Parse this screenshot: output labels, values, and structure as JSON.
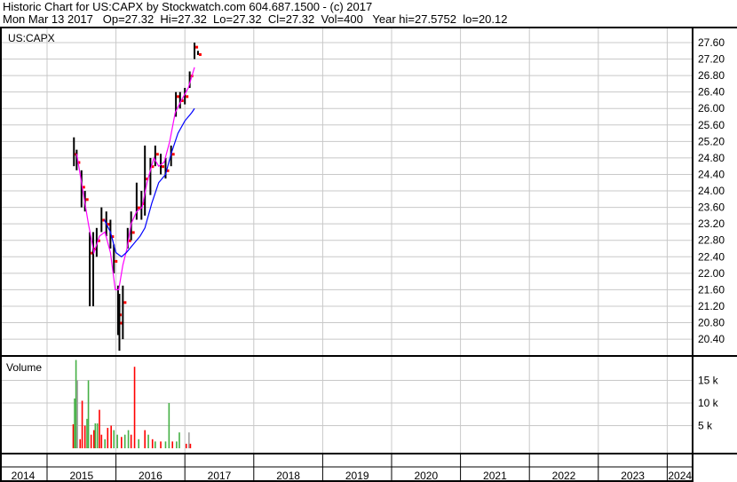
{
  "header": {
    "line1": "Historic Chart for US:CAPX by Stockwatch.com 604.687.1500 - (c) 2017",
    "line2": "Mon Mar 13 2017   Op=27.32  Hi=27.32  Lo=27.32  Cl=27.32  Vol=400   Year hi=27.5752  lo=20.12"
  },
  "chart_data": {
    "type": "line",
    "title": "US:CAPX",
    "volume_label": "Volume",
    "price_ticks": [
      "27.60",
      "27.20",
      "26.80",
      "26.40",
      "26.00",
      "25.60",
      "25.20",
      "24.80",
      "24.40",
      "24.00",
      "23.60",
      "23.20",
      "22.80",
      "22.40",
      "22.00",
      "21.60",
      "21.20",
      "20.80",
      "20.40"
    ],
    "volume_ticks": [
      "15 k",
      "10 k",
      "5 k"
    ],
    "volume_tick_values": [
      15,
      10,
      5
    ],
    "years": [
      "2014",
      "2015",
      "2016",
      "2017",
      "2018",
      "2019",
      "2020",
      "2021",
      "2022",
      "2023",
      "2024"
    ],
    "ylim": [
      20.4,
      27.6
    ],
    "colors": {
      "up": "#44b044",
      "down": "#ff0000",
      "flat": "#a0a0a0",
      "bar": "#000000",
      "ma_short": "#ff00ff",
      "ma_long": "#0000ff"
    },
    "price": [
      {
        "t": 2015.39,
        "h": 25.3,
        "l": 24.6,
        "c": 24.9
      },
      {
        "t": 2015.43,
        "h": 25.0,
        "l": 24.5,
        "c": 24.7
      },
      {
        "t": 2015.5,
        "h": 24.5,
        "l": 23.6,
        "c": 24.1
      },
      {
        "t": 2015.55,
        "h": 24.0,
        "l": 23.5,
        "c": 23.8
      },
      {
        "t": 2015.62,
        "h": 23.0,
        "l": 21.2,
        "c": 22.5
      },
      {
        "t": 2015.67,
        "h": 23.0,
        "l": 21.2,
        "c": 22.6
      },
      {
        "t": 2015.72,
        "h": 23.1,
        "l": 22.4,
        "c": 22.8
      },
      {
        "t": 2015.79,
        "h": 23.6,
        "l": 23.0,
        "c": 23.3
      },
      {
        "t": 2015.86,
        "h": 23.5,
        "l": 22.9,
        "c": 23.2
      },
      {
        "t": 2015.92,
        "h": 23.3,
        "l": 22.6,
        "c": 22.9
      },
      {
        "t": 2015.97,
        "h": 22.7,
        "l": 22.0,
        "c": 22.3
      },
      {
        "t": 2016.03,
        "h": 21.7,
        "l": 20.5,
        "c": 21.0
      },
      {
        "t": 2016.05,
        "h": 21.5,
        "l": 20.12,
        "c": 20.8
      },
      {
        "t": 2016.1,
        "h": 21.7,
        "l": 20.4,
        "c": 21.3
      },
      {
        "t": 2016.17,
        "h": 23.1,
        "l": 22.6,
        "c": 22.8
      },
      {
        "t": 2016.22,
        "h": 23.5,
        "l": 22.8,
        "c": 23.0
      },
      {
        "t": 2016.3,
        "h": 24.2,
        "l": 23.3,
        "c": 23.6
      },
      {
        "t": 2016.37,
        "h": 24.0,
        "l": 23.3,
        "c": 23.7
      },
      {
        "t": 2016.42,
        "h": 25.1,
        "l": 23.4,
        "c": 24.3
      },
      {
        "t": 2016.5,
        "h": 24.8,
        "l": 23.9,
        "c": 24.6
      },
      {
        "t": 2016.57,
        "h": 25.1,
        "l": 24.6,
        "c": 24.9
      },
      {
        "t": 2016.65,
        "h": 24.9,
        "l": 24.4,
        "c": 24.6
      },
      {
        "t": 2016.72,
        "h": 24.8,
        "l": 24.3,
        "c": 24.5
      },
      {
        "t": 2016.8,
        "h": 25.1,
        "l": 24.6,
        "c": 24.9
      },
      {
        "t": 2016.87,
        "h": 26.4,
        "l": 25.8,
        "c": 26.3
      },
      {
        "t": 2016.93,
        "h": 26.4,
        "l": 26.0,
        "c": 26.2
      },
      {
        "t": 2017.0,
        "h": 26.5,
        "l": 26.1,
        "c": 26.3
      },
      {
        "t": 2017.07,
        "h": 26.9,
        "l": 26.5,
        "c": 26.8
      },
      {
        "t": 2017.14,
        "h": 27.6,
        "l": 27.2,
        "c": 27.5
      },
      {
        "t": 2017.19,
        "h": 27.4,
        "l": 27.3,
        "c": 27.32
      }
    ],
    "ma_short": [
      [
        2015.43,
        24.9
      ],
      [
        2015.52,
        24.0
      ],
      [
        2015.6,
        23.2
      ],
      [
        2015.68,
        22.5
      ],
      [
        2015.76,
        22.9
      ],
      [
        2015.84,
        23.0
      ],
      [
        2015.92,
        22.5
      ],
      [
        2015.99,
        21.6
      ],
      [
        2016.04,
        21.6
      ],
      [
        2016.1,
        22.2
      ],
      [
        2016.16,
        22.6
      ],
      [
        2016.22,
        23.2
      ],
      [
        2016.3,
        23.5
      ],
      [
        2016.38,
        23.6
      ],
      [
        2016.45,
        24.2
      ],
      [
        2016.55,
        24.8
      ],
      [
        2016.62,
        24.6
      ],
      [
        2016.7,
        24.7
      ],
      [
        2016.78,
        25.2
      ],
      [
        2016.86,
        25.9
      ],
      [
        2016.95,
        26.2
      ],
      [
        2017.05,
        26.5
      ],
      [
        2017.14,
        27.0
      ]
    ],
    "ma_long": [
      [
        2015.83,
        23.3
      ],
      [
        2015.92,
        23.0
      ],
      [
        2016.0,
        22.5
      ],
      [
        2016.08,
        22.4
      ],
      [
        2016.15,
        22.5
      ],
      [
        2016.25,
        22.7
      ],
      [
        2016.35,
        22.9
      ],
      [
        2016.42,
        23.1
      ],
      [
        2016.52,
        23.7
      ],
      [
        2016.62,
        24.2
      ],
      [
        2016.72,
        24.4
      ],
      [
        2016.8,
        24.9
      ],
      [
        2016.9,
        25.4
      ],
      [
        2017.0,
        25.7
      ],
      [
        2017.1,
        25.9
      ],
      [
        2017.14,
        26.0
      ]
    ],
    "volume": [
      [
        2015.38,
        5.3,
        "down"
      ],
      [
        2015.4,
        11,
        "up"
      ],
      [
        2015.42,
        19.5,
        "up"
      ],
      [
        2015.44,
        15,
        "flat"
      ],
      [
        2015.48,
        2,
        "down"
      ],
      [
        2015.51,
        10.5,
        "down"
      ],
      [
        2015.55,
        5,
        "down"
      ],
      [
        2015.58,
        6.5,
        "up"
      ],
      [
        2015.6,
        15,
        "up"
      ],
      [
        2015.64,
        3,
        "down"
      ],
      [
        2015.68,
        4,
        "down"
      ],
      [
        2015.7,
        5.5,
        "up"
      ],
      [
        2015.73,
        5.5,
        "up"
      ],
      [
        2015.76,
        8.5,
        "down"
      ],
      [
        2015.79,
        3,
        "down"
      ],
      [
        2015.84,
        2,
        "up"
      ],
      [
        2015.88,
        4.5,
        "down"
      ],
      [
        2015.93,
        5,
        "down"
      ],
      [
        2015.97,
        4,
        "up"
      ],
      [
        2016.02,
        3,
        "up"
      ],
      [
        2016.08,
        2.5,
        "down"
      ],
      [
        2016.13,
        3,
        "up"
      ],
      [
        2016.18,
        4,
        "up"
      ],
      [
        2016.22,
        3,
        "down"
      ],
      [
        2016.27,
        18,
        "down"
      ],
      [
        2016.33,
        2,
        "up"
      ],
      [
        2016.42,
        4,
        "down"
      ],
      [
        2016.47,
        3,
        "up"
      ],
      [
        2016.53,
        2,
        "down"
      ],
      [
        2016.57,
        1.5,
        "up"
      ],
      [
        2016.65,
        1.5,
        "down"
      ],
      [
        2016.72,
        1.5,
        "up"
      ],
      [
        2016.77,
        10,
        "up"
      ],
      [
        2016.82,
        1.5,
        "down"
      ],
      [
        2016.88,
        1.5,
        "up"
      ],
      [
        2016.92,
        3.5,
        "up"
      ],
      [
        2017.02,
        1,
        "down"
      ],
      [
        2017.06,
        3.5,
        "flat"
      ],
      [
        2017.08,
        1,
        "down"
      ]
    ]
  }
}
